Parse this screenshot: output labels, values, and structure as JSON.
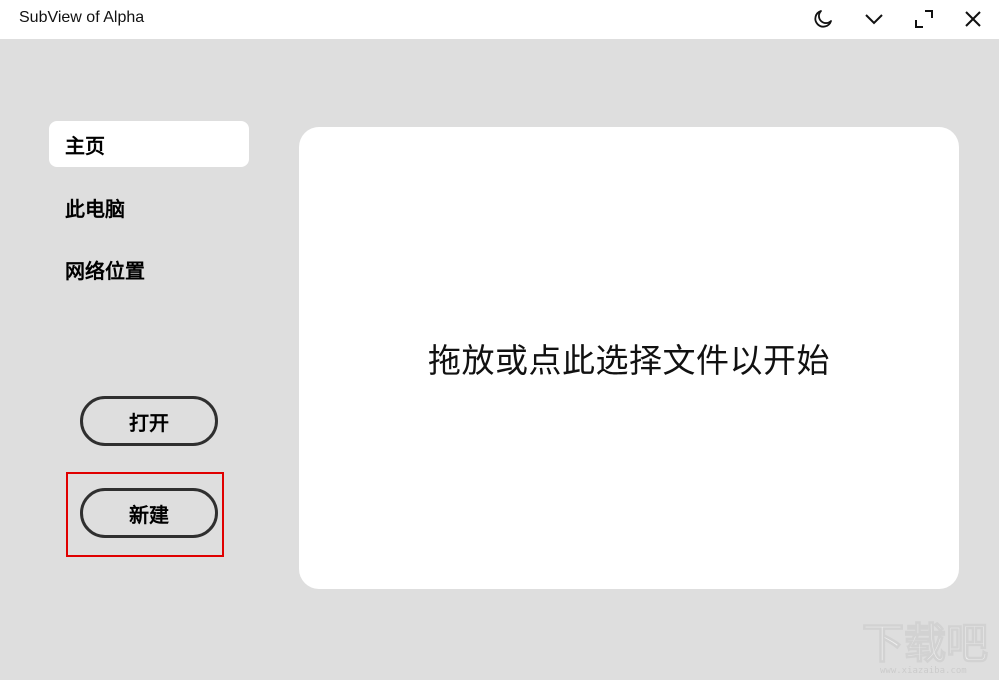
{
  "window": {
    "title": "SubView of Alpha",
    "controls": [
      {
        "name": "theme-toggle-icon"
      },
      {
        "name": "minimize-chevron-icon"
      },
      {
        "name": "maximize-icon"
      },
      {
        "name": "close-icon"
      }
    ]
  },
  "sidebar": {
    "items": [
      {
        "label": "主页",
        "active": true
      },
      {
        "label": "此电脑",
        "active": false
      },
      {
        "label": "网络位置",
        "active": false
      }
    ]
  },
  "actions": {
    "open_label": "打开",
    "new_label": "新建"
  },
  "main": {
    "drop_prompt": "拖放或点此选择文件以开始"
  },
  "watermark": {
    "text": "下载吧",
    "url": "www.xiazaiba.com"
  },
  "colors": {
    "background": "#dedede",
    "panel": "#ffffff",
    "highlight": "#e00000",
    "pill_border": "#2f2f2f"
  }
}
